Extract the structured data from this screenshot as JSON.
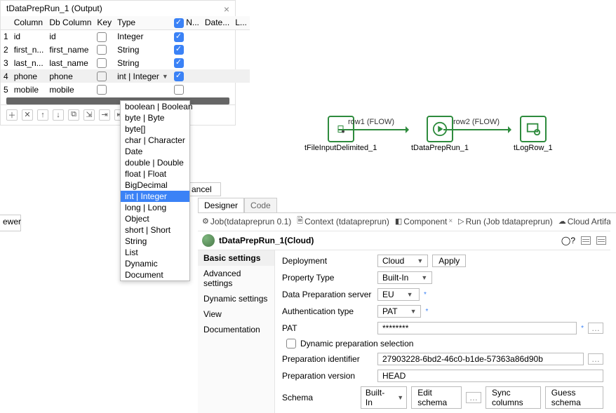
{
  "dialog": {
    "title": "tDataPrepRun_1 (Output)",
    "headers": {
      "blank": "",
      "column": "Column",
      "dbcolumn": "Db Column",
      "key": "Key",
      "type": "Type",
      "n": "N...",
      "date": "Date...",
      "l": "L..."
    },
    "rows": [
      {
        "idx": "1",
        "col": "id",
        "db": "id",
        "type": "Integer",
        "n": true
      },
      {
        "idx": "2",
        "col": "first_n...",
        "db": "first_name",
        "type": "String",
        "n": true
      },
      {
        "idx": "3",
        "col": "last_n...",
        "db": "last_name",
        "type": "String",
        "n": true
      },
      {
        "idx": "4",
        "col": "phone",
        "db": "phone",
        "type": "int | Integer",
        "n": true
      },
      {
        "idx": "5",
        "col": "mobile",
        "db": "mobile",
        "type": "",
        "n": false
      }
    ],
    "typeOptions": [
      "boolean | Boolean",
      "byte | Byte",
      "byte[]",
      "char | Character",
      "Date",
      "double | Double",
      "float | Float",
      "BigDecimal",
      "int | Integer",
      "long | Long",
      "Object",
      "short | Short",
      "String",
      "List",
      "Dynamic",
      "Document"
    ],
    "selectedType": "int | Integer",
    "cancel": "ancel"
  },
  "canvas": {
    "n1": "tFileInputDelimited_1",
    "n2": "tDataPrepRun_1",
    "n3": "tLogRow_1",
    "f1": "row1 (FLOW)",
    "f2": "row2 (FLOW)"
  },
  "viewerTab": "ewer",
  "tabs": {
    "designer": "Designer",
    "code": "Code"
  },
  "subtabs": {
    "job": "Job(tdatapreprun 0.1)",
    "context": "Context (tdatapreprun)",
    "component": "Component",
    "run": "Run (Job tdatapreprun)",
    "cloud": "Cloud Artifact"
  },
  "component": {
    "title": "tDataPrepRun_1(Cloud)",
    "nav": {
      "basic": "Basic settings",
      "advanced": "Advanced settings",
      "dynamic": "Dynamic settings",
      "view": "View",
      "doc": "Documentation"
    },
    "form": {
      "deployment_l": "Deployment",
      "deployment_v": "Cloud",
      "apply": "Apply",
      "proptype_l": "Property Type",
      "proptype_v": "Built-In",
      "server_l": "Data Preparation server",
      "server_v": "EU",
      "auth_l": "Authentication type",
      "auth_v": "PAT",
      "pat_l": "PAT",
      "pat_v": "********",
      "dynp": "Dynamic preparation selection",
      "prepid_l": "Preparation identifier",
      "prepid_v": "27903228-6bd2-46c0-b1de-57363a86d90b",
      "prepver_l": "Preparation version",
      "prepver_v": "HEAD",
      "schema_l": "Schema",
      "schema_v": "Built-In",
      "edit": "Edit schema",
      "sync": "Sync columns",
      "guess": "Guess schema"
    }
  }
}
